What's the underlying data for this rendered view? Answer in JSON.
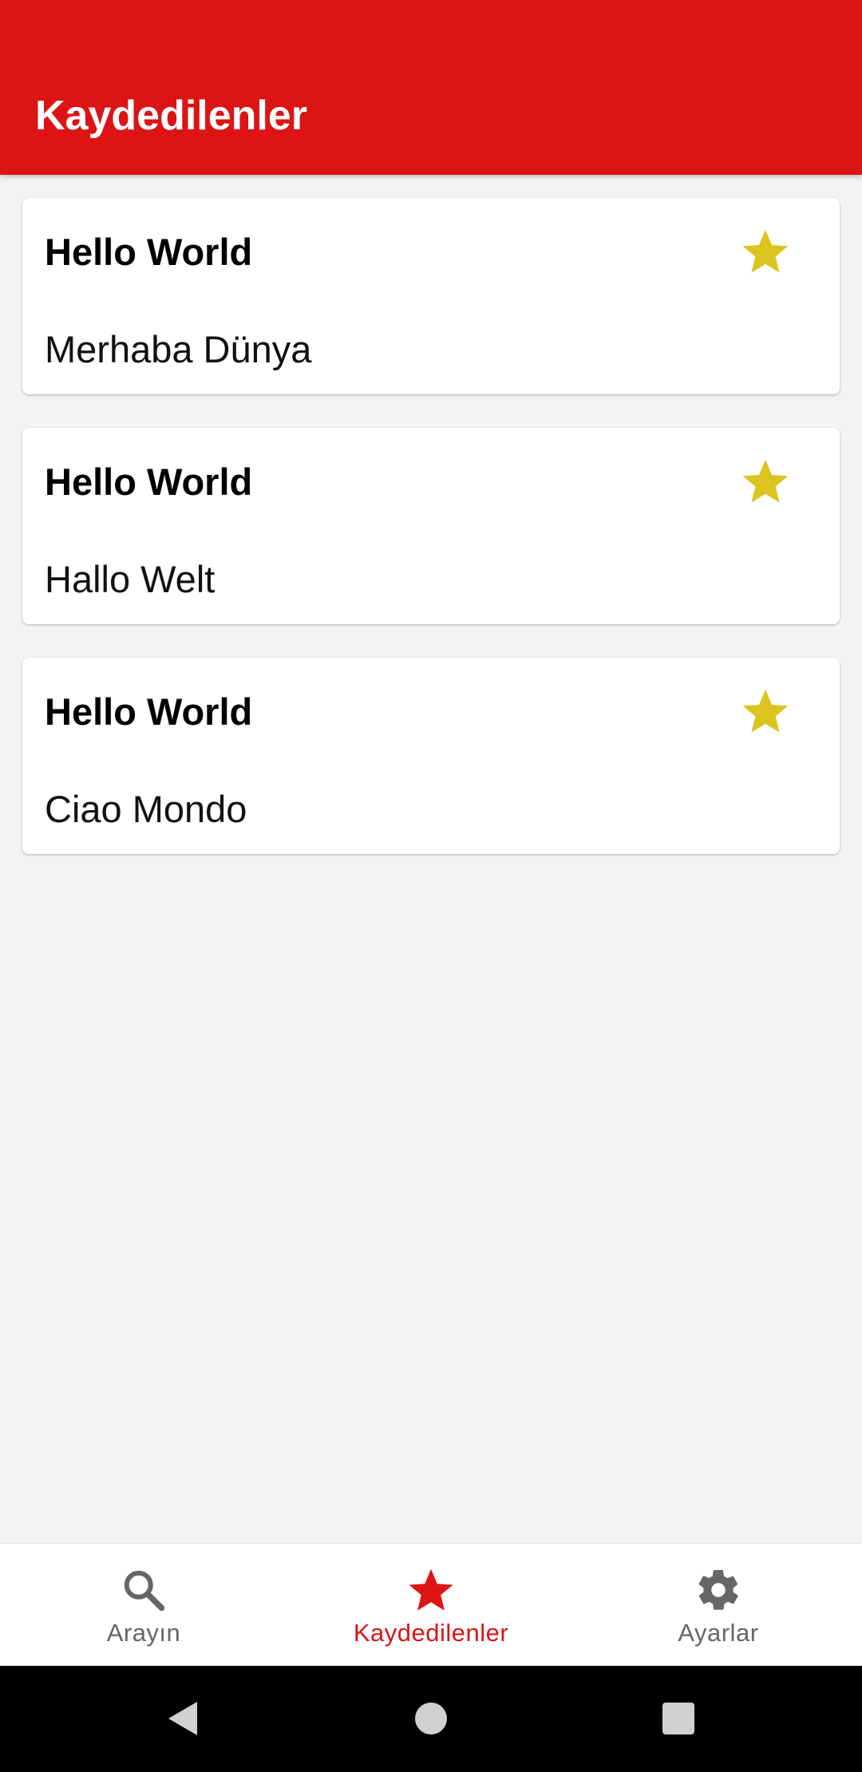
{
  "appbar": {
    "title": "Kaydedilenler",
    "background": "#dc1414"
  },
  "saved_items": [
    {
      "source": "Hello World",
      "translation": "Merhaba Dünya",
      "starred": true,
      "star_icon": "star-icon"
    },
    {
      "source": "Hello World",
      "translation": "Hallo Welt",
      "starred": true,
      "star_icon": "star-icon"
    },
    {
      "source": "Hello World",
      "translation": "Ciao Mondo",
      "starred": true,
      "star_icon": "star-icon"
    }
  ],
  "colors": {
    "accent": "#dc1414",
    "star": "#dcc41e",
    "inactive": "#666666"
  },
  "bottom_nav": {
    "items": [
      {
        "label": "Arayın",
        "icon": "search-icon",
        "active": false
      },
      {
        "label": "Kaydedilenler",
        "icon": "star-icon",
        "active": true
      },
      {
        "label": "Ayarlar",
        "icon": "gear-icon",
        "active": false
      }
    ]
  },
  "system_nav": {
    "buttons": [
      "back-icon",
      "home-icon",
      "recents-icon"
    ]
  }
}
